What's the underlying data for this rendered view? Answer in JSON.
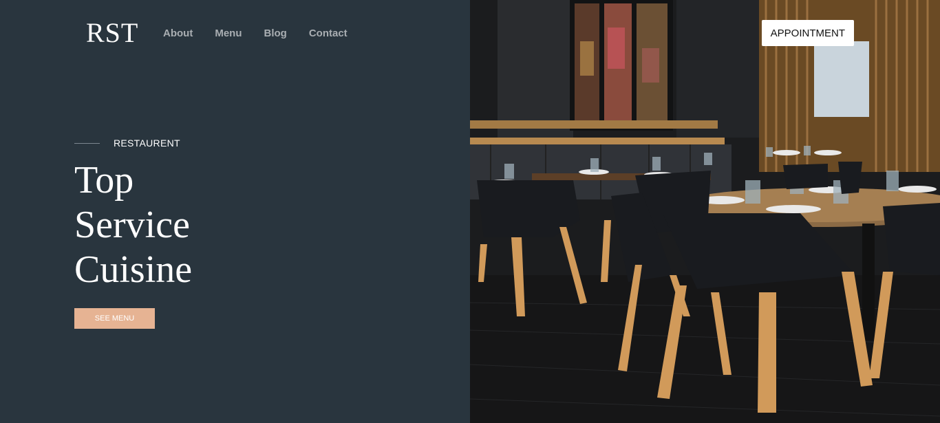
{
  "brand": {
    "logo": "RST"
  },
  "nav": {
    "items": [
      "About",
      "Menu",
      "Blog",
      "Contact"
    ]
  },
  "header": {
    "appointment_label": "APPOINTMENT"
  },
  "hero": {
    "eyebrow": "RESTAURENT",
    "title_lines": [
      "Top",
      "Service",
      "Cuisine"
    ],
    "cta_label": "SEE MENU"
  },
  "colors": {
    "panel": "#29353e",
    "accent": "#e6b393",
    "nav_text": "#a9aeb2"
  },
  "image": {
    "subject": "restaurant-interior-photo"
  }
}
